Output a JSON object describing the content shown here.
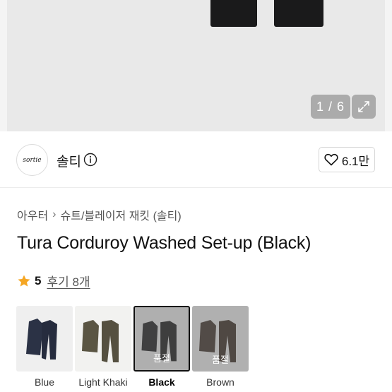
{
  "gallery": {
    "counter": "1 / 6"
  },
  "seller": {
    "avatar_text": "sortie",
    "name": "솔티",
    "likes": "6.1만"
  },
  "breadcrumb": [
    "아우터",
    "슈트/블레이저 재킷 (솔티)"
  ],
  "product": {
    "title": "Tura Corduroy Washed Set-up (Black)"
  },
  "rating": {
    "score": "5",
    "reviews": "후기 8개"
  },
  "options": [
    {
      "label": "Blue",
      "sold_out": "",
      "color": "#2b3245"
    },
    {
      "label": "Light Khaki",
      "sold_out": "",
      "color": "#5a5543"
    },
    {
      "label": "Black",
      "sold_out": "품절",
      "color": "#1b1b1c"
    },
    {
      "label": "Brown",
      "sold_out": "품절",
      "color": "#3b2e27"
    }
  ],
  "colors": {
    "star": "#f5a623",
    "hero_bg": "#e9e9e9"
  }
}
